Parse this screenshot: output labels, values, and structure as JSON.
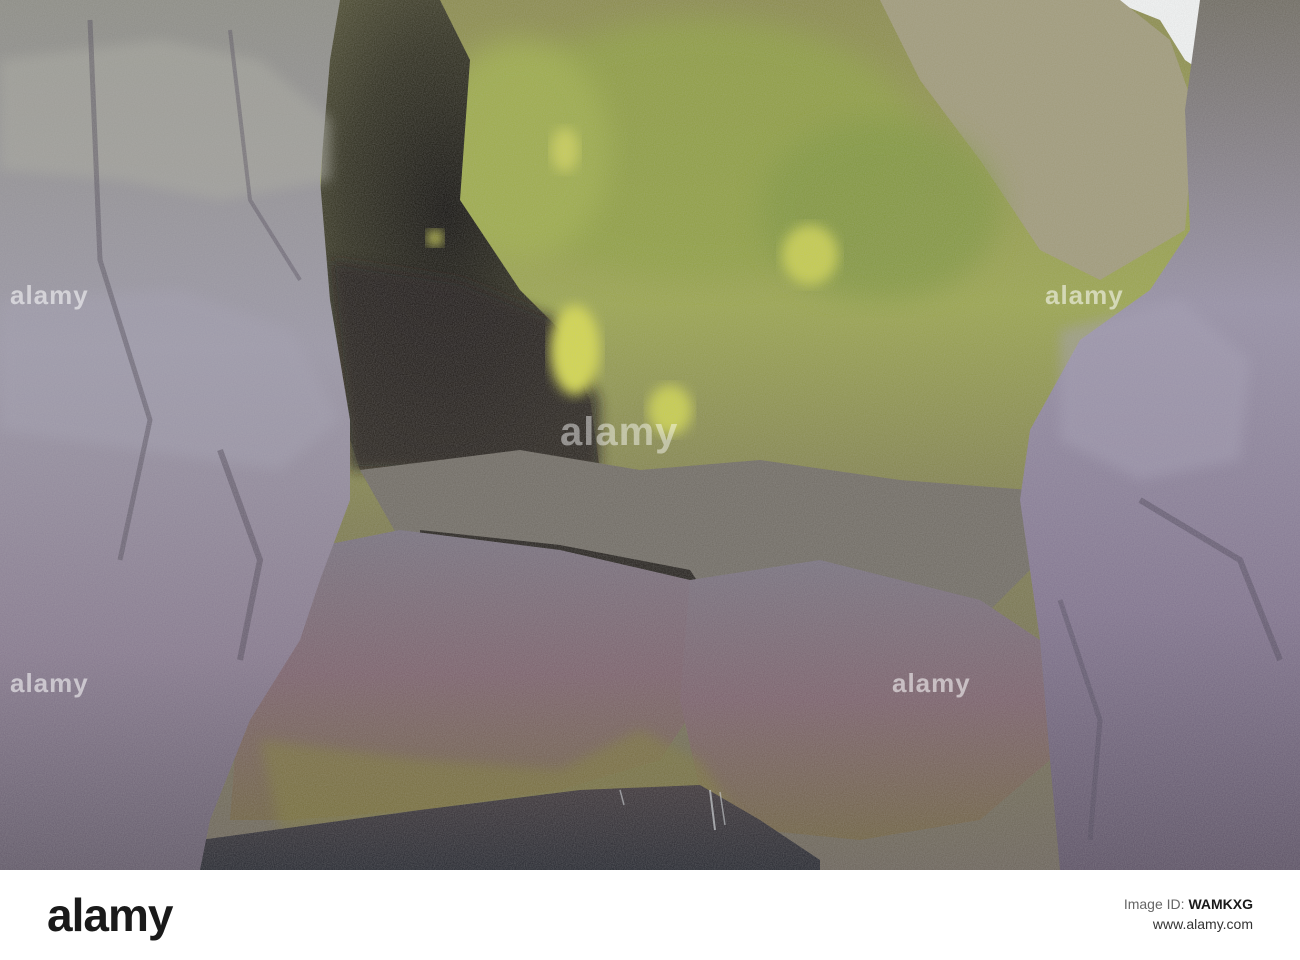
{
  "photo": {
    "subject": "sea-cave-rock-formation"
  },
  "watermark": {
    "text": "alamy"
  },
  "footer": {
    "logo": "alamy",
    "image_id_label": "Image ID:",
    "image_id": "WAMKXG",
    "site": "www.alamy.com"
  },
  "colors": {
    "rock_lilac": "#8a7f96",
    "moss_green": "#9aa548",
    "bright_lichen": "#d4d84a",
    "shadow": "#15120f",
    "water": "#2a2a30",
    "sky": "#f4f6f6"
  }
}
